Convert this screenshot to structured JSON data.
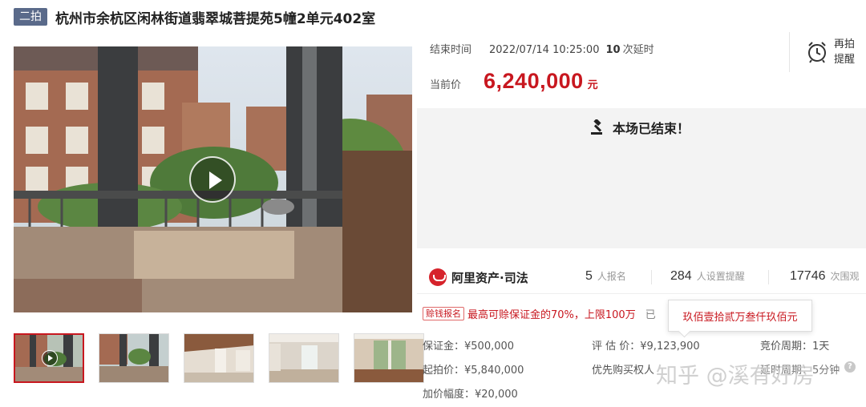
{
  "header": {
    "tag": "二拍",
    "title": "杭州市余杭区闲林街道翡翠城菩提苑5幢2单元402室"
  },
  "auction": {
    "end_label": "结束时间",
    "end_time": "2022/07/14 10:25:00",
    "delay_count": "10",
    "delay_label": "次延时",
    "remind_label": "再拍提醒",
    "price_label": "当前价",
    "price": "6,240,000",
    "price_unit": "元",
    "ended_text": "本场已结束！"
  },
  "platform": {
    "logo_text": "阿里资产·司法"
  },
  "stats": {
    "signups": "5",
    "signups_label": "人报名",
    "reminders": "284",
    "reminders_label": "人设置提醒",
    "views": "17746",
    "views_label": "次围观"
  },
  "deposit_bar": {
    "tag": "赊钱报名",
    "text": "最高可赊保证金的70%，上限100万",
    "more": "已",
    "tooltip": "玖佰壹拾贰万叁仟玖佰元"
  },
  "details": {
    "deposit": "保证金：¥500,000",
    "start_price": "起拍价：¥5,840,000",
    "increment": "加价幅度：¥20,000",
    "appraisal": "评 估 价：¥9,123,900",
    "priority": "优先购买权人",
    "cycle": "竞价周期：1天",
    "cycle2": "延时周期：5分钟"
  },
  "watermark": "知乎 @溪有好房",
  "icons": {
    "alarm": "alarm-clock-icon",
    "gavel": "gavel-icon",
    "play": "play-icon",
    "help": "help-icon"
  },
  "colors": {
    "accent": "#c8171f",
    "tag_bg": "#5a6a8a"
  }
}
